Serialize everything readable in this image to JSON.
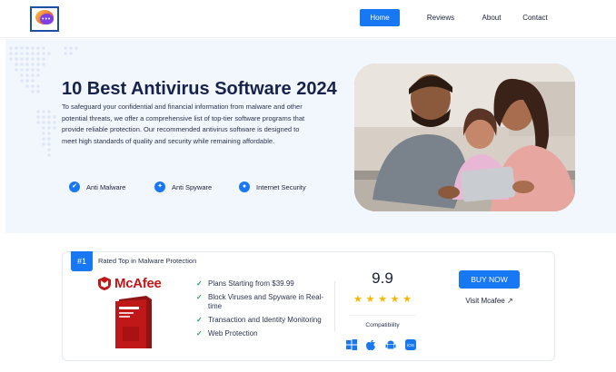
{
  "header": {
    "nav": [
      "Home",
      "Reviews",
      "About",
      "Contact"
    ],
    "active_nav": "Home"
  },
  "hero": {
    "title": "10 Best Antivirus Software 2024",
    "description": "To safeguard your confidential and financial information from malware and other potential threats, we offer a comprehensive list of top-tier software programs that provide reliable protection. Our recommended antivirus software is designed to meet high standards of quality and security while remaining affordable.",
    "features": [
      {
        "label": "Anti Malware",
        "icon": "shield-icon"
      },
      {
        "label": "Anti Spyware",
        "icon": "spy-shield-icon"
      },
      {
        "label": "Internet Security",
        "icon": "lock-icon"
      }
    ]
  },
  "listing": {
    "rank": "#1",
    "rank_label": "Rated Top in Malware Protection",
    "brand": "McAfee",
    "features": [
      "Plans Starting from $39.99",
      "Block Viruses and Spyware in Real-time",
      "Transaction and Identity Monitoring",
      "Web Protection"
    ],
    "score": "9.9",
    "stars": 5,
    "compatibility_label": "Compatibility",
    "platforms": [
      "windows-icon",
      "apple-icon",
      "android-icon",
      "ios-icon"
    ],
    "ios_text": "iOS",
    "cta": "BUY NOW",
    "visit": "Visit Mcafee ↗"
  },
  "colors": {
    "accent": "#1877f2",
    "brand_red": "#c01818",
    "star": "#f5b800",
    "check": "#1fa84a",
    "hero_bg": "#f2f6fd"
  }
}
